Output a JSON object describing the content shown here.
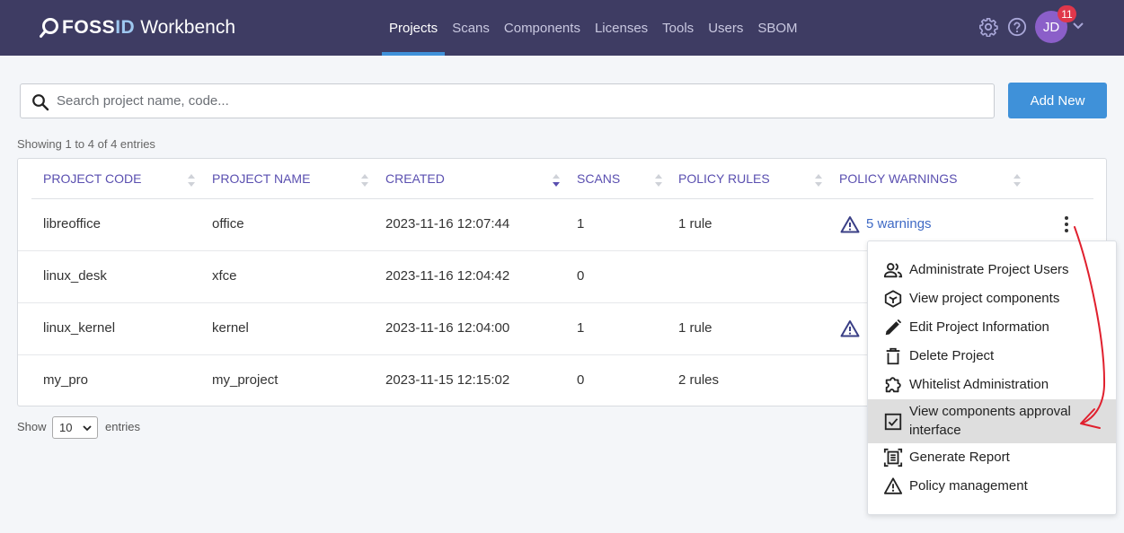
{
  "header": {
    "logo_brand_a": "FOSS",
    "logo_brand_b": "ID",
    "logo_product": "Workbench",
    "nav": [
      "Projects",
      "Scans",
      "Components",
      "Licenses",
      "Tools",
      "Users",
      "SBOM"
    ],
    "active_nav": "Projects",
    "avatar_initials": "JD",
    "notification_count": "11",
    "icons": [
      "settings-icon",
      "help-icon",
      "chevron-down-icon"
    ]
  },
  "search": {
    "placeholder": "Search project name, code...",
    "value": ""
  },
  "add_new_label": "Add New",
  "showing_text": "Showing 1 to 4 of 4 entries",
  "table": {
    "columns": [
      "PROJECT CODE",
      "PROJECT NAME",
      "CREATED",
      "SCANS",
      "POLICY RULES",
      "POLICY WARNINGS"
    ],
    "rows": [
      {
        "code": "libreoffice",
        "name": "office",
        "created": "2023-11-16 12:07:44",
        "scans": "1",
        "rules": "1 rule",
        "warnings": "5 warnings",
        "has_warning_icon": true
      },
      {
        "code": "linux_desk",
        "name": "xfce",
        "created": "2023-11-16 12:04:42",
        "scans": "0",
        "rules": "",
        "warnings": "",
        "has_warning_icon": false
      },
      {
        "code": "linux_kernel",
        "name": "kernel",
        "created": "2023-11-16 12:04:00",
        "scans": "1",
        "rules": "1 rule",
        "warnings": "",
        "has_warning_icon": true
      },
      {
        "code": "my_pro",
        "name": "my_project",
        "created": "2023-11-15 12:15:02",
        "scans": "0",
        "rules": "2 rules",
        "warnings": "",
        "has_warning_icon": false
      }
    ]
  },
  "pagination": {
    "show_label": "Show",
    "entries_label": "entries",
    "page_size": "10"
  },
  "row_menu": {
    "items": [
      {
        "label": "Administrate Project Users",
        "icon": "users-icon"
      },
      {
        "label": "View project components",
        "icon": "cube-icon"
      },
      {
        "label": "Edit Project Information",
        "icon": "pencil-icon"
      },
      {
        "label": "Delete Project",
        "icon": "trash-icon"
      },
      {
        "label": "Whitelist Administration",
        "icon": "puzzle-icon"
      },
      {
        "label": "View components approval interface",
        "icon": "checkbox-icon",
        "highlighted": true
      },
      {
        "label": "Generate Report",
        "icon": "report-icon"
      },
      {
        "label": "Policy management",
        "icon": "warning-icon"
      }
    ]
  },
  "colors": {
    "header_bg": "#3e3c63",
    "accent": "#3f91d9",
    "header_text": "#5a4fb0",
    "annotation_arrow": "#e0202e"
  }
}
